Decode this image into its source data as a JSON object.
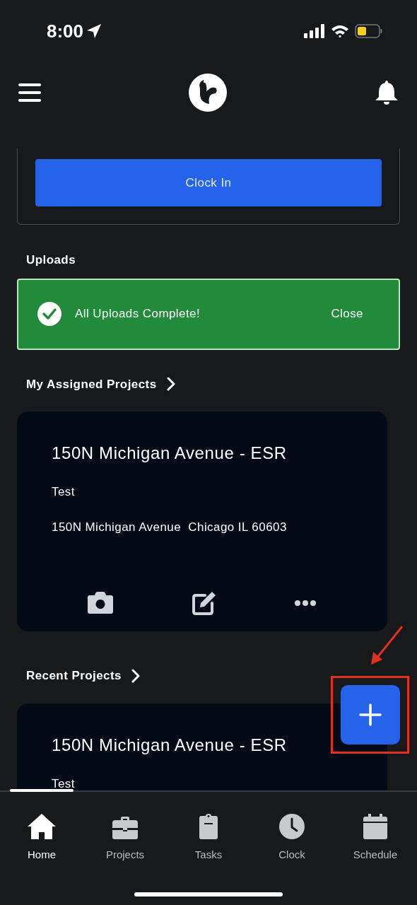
{
  "status_bar": {
    "time": "8:00"
  },
  "clock_in": {
    "label": "Clock In"
  },
  "uploads": {
    "title": "Uploads",
    "banner": {
      "message": "All Uploads Complete!",
      "close": "Close"
    }
  },
  "assigned": {
    "title": "My Assigned Projects",
    "projects": [
      {
        "name": "150N Michigan Avenue - ESR",
        "subtitle": "Test",
        "address": "150N Michigan Avenue  Chicago IL 60603"
      }
    ]
  },
  "recent": {
    "title": "Recent Projects",
    "projects": [
      {
        "name": "150N Michigan Avenue - ESR",
        "subtitle": "Test"
      }
    ]
  },
  "tabs": [
    {
      "label": "Home",
      "kind": "home",
      "selected": true
    },
    {
      "label": "Projects",
      "kind": "projects",
      "selected": false
    },
    {
      "label": "Tasks",
      "kind": "tasks",
      "selected": false
    },
    {
      "label": "Clock",
      "kind": "clock",
      "selected": false
    },
    {
      "label": "Schedule",
      "kind": "schedule",
      "selected": false
    }
  ]
}
